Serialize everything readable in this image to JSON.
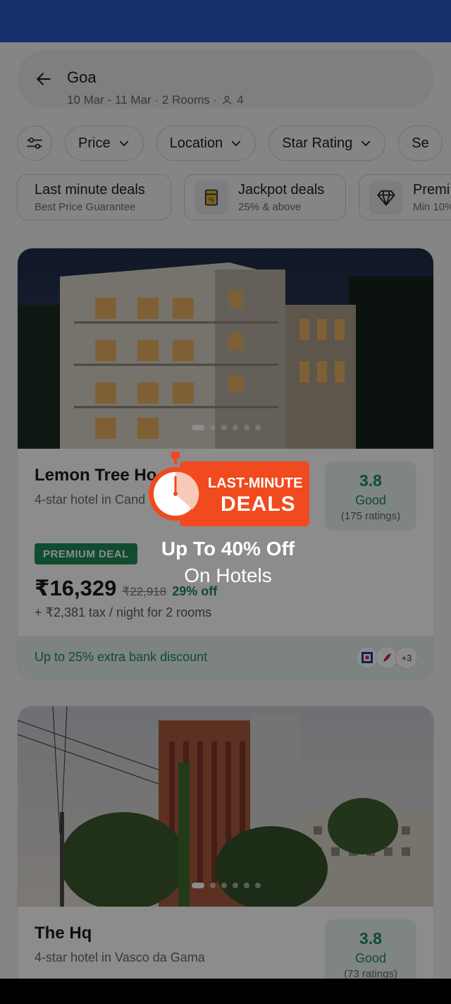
{
  "search": {
    "city": "Goa",
    "meta": "10 Mar - 11 Mar · 2 Rooms ·",
    "guests": "4"
  },
  "filters": [
    "Price",
    "Location",
    "Star Rating",
    "Se"
  ],
  "deals": [
    {
      "title": "Last minute deals",
      "sub": "Best Price Guarantee"
    },
    {
      "title": "Jackpot deals",
      "sub": "25% & above"
    },
    {
      "title": "Premi",
      "sub": "Min 10%"
    }
  ],
  "hotels": [
    {
      "name": "Lemon Tree Ho",
      "sub": "4-star hotel in Cand",
      "rating": "3.8",
      "rating_word": "Good",
      "rating_count": "(175 ratings)",
      "badge": "PREMIUM DEAL",
      "price": "₹16,329",
      "original_price": "₹22,918",
      "discount": "29% off",
      "tax": "+ ₹2,381 tax / night for 2 rooms",
      "bank_offer": "Up to 25% extra bank discount",
      "bank_more": "+3"
    },
    {
      "name": "The Hq",
      "sub": "4-star hotel in Vasco da Gama",
      "rating": "3.8",
      "rating_word": "Good",
      "rating_count": "(73 ratings)"
    }
  ],
  "promo": {
    "line1": "LAST-MINUTE",
    "line2": "DEALS",
    "offer": "Up To 40% Off",
    "sub": "On Hotels"
  },
  "colors": {
    "status_bar": "#2b56c4",
    "accent_green": "#1a8a5a",
    "promo_orange": "#f04a1e"
  }
}
